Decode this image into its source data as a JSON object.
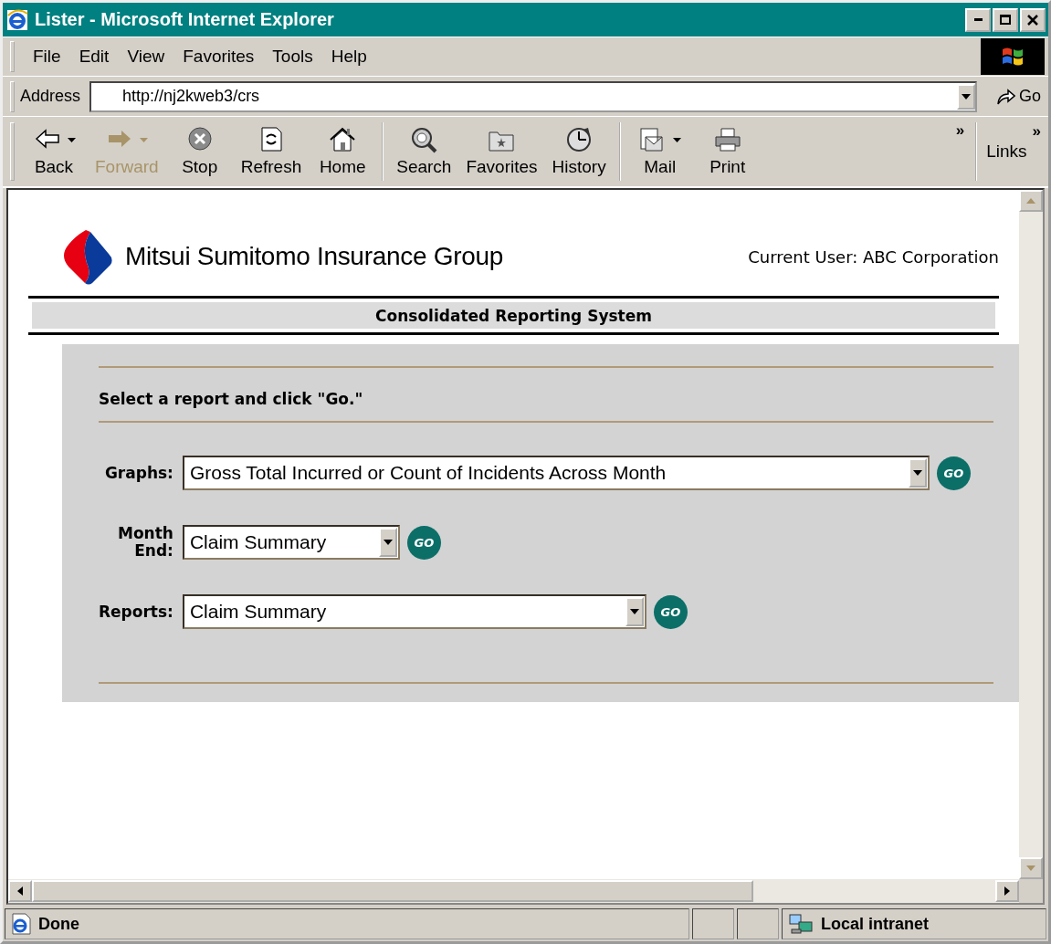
{
  "window": {
    "title": "Lister - Microsoft Internet Explorer"
  },
  "menu": [
    {
      "label": "File"
    },
    {
      "label": "Edit"
    },
    {
      "label": "View"
    },
    {
      "label": "Favorites"
    },
    {
      "label": "Tools"
    },
    {
      "label": "Help"
    }
  ],
  "address": {
    "label": "Address",
    "value": "http://nj2kweb3/crs",
    "go": "Go"
  },
  "toolbar": {
    "groups": [
      [
        {
          "kind": "back",
          "label": "Back",
          "disabled": false,
          "dropdown": true
        },
        {
          "kind": "forward",
          "label": "Forward",
          "disabled": true,
          "dropdown": true
        },
        {
          "kind": "stop",
          "label": "Stop",
          "disabled": false,
          "dropdown": false
        },
        {
          "kind": "refresh",
          "label": "Refresh",
          "disabled": false,
          "dropdown": false
        },
        {
          "kind": "home",
          "label": "Home",
          "disabled": false,
          "dropdown": false
        }
      ],
      [
        {
          "kind": "search",
          "label": "Search",
          "disabled": false,
          "dropdown": false
        },
        {
          "kind": "favorites",
          "label": "Favorites",
          "disabled": false,
          "dropdown": false
        },
        {
          "kind": "history",
          "label": "History",
          "disabled": false,
          "dropdown": false
        }
      ],
      [
        {
          "kind": "mail",
          "label": "Mail",
          "disabled": false,
          "dropdown": true
        },
        {
          "kind": "print",
          "label": "Print",
          "disabled": false,
          "dropdown": false
        }
      ]
    ],
    "more": "»",
    "links": "Links",
    "links_more": "»"
  },
  "page": {
    "logo_text": "Mitsui Sumitomo Insurance Group",
    "current_user": "Current User: ABC Corporation",
    "banner": "Consolidated Reporting System",
    "instruction": "Select a report and click \"Go.\"",
    "fields": [
      {
        "label": "Graphs:",
        "value": "Gross Total Incurred or Count of Incidents Across Month",
        "go": "GO"
      },
      {
        "label": "Month End:",
        "value": "Claim Summary",
        "go": "GO"
      },
      {
        "label": "Reports:",
        "value": "Claim Summary",
        "go": "GO"
      }
    ]
  },
  "status_bar": {
    "text": "Done",
    "zone": "Local intranet"
  }
}
